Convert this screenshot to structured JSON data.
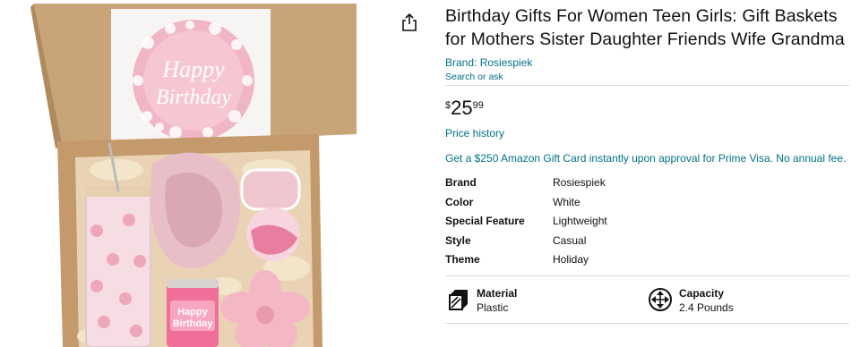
{
  "product": {
    "title": "Birthday Gifts For Women Teen Girls: Gift Baskets for Mothers Sister Daughter Friends Wife Grandma",
    "brand_link": "Brand: Rosiespiek",
    "search_link": "Search or ask",
    "image_text": {
      "card_line1": "Happy",
      "card_line2": "Birthday",
      "candle_line1": "Happy",
      "candle_line2": "Birthday"
    }
  },
  "price": {
    "symbol": "$",
    "whole": "25",
    "fraction": "99",
    "history_link": "Price history"
  },
  "promo": "Get a $250 Amazon Gift Card instantly upon approval for Prime Visa. No annual fee.",
  "specs": [
    {
      "label": "Brand",
      "value": "Rosiespiek"
    },
    {
      "label": "Color",
      "value": "White"
    },
    {
      "label": "Special Feature",
      "value": "Lightweight"
    },
    {
      "label": "Style",
      "value": "Casual"
    },
    {
      "label": "Theme",
      "value": "Holiday"
    }
  ],
  "features": [
    {
      "label": "Material",
      "value": "Plastic",
      "icon": "material-icon"
    },
    {
      "label": "Capacity",
      "value": "2.4 Pounds",
      "icon": "capacity-icon"
    }
  ],
  "icons": {
    "share": "share-icon"
  },
  "colors": {
    "link": "#007185",
    "text": "#0f1111",
    "divider": "#d5d9d9",
    "pink": "#f4b8c8"
  }
}
